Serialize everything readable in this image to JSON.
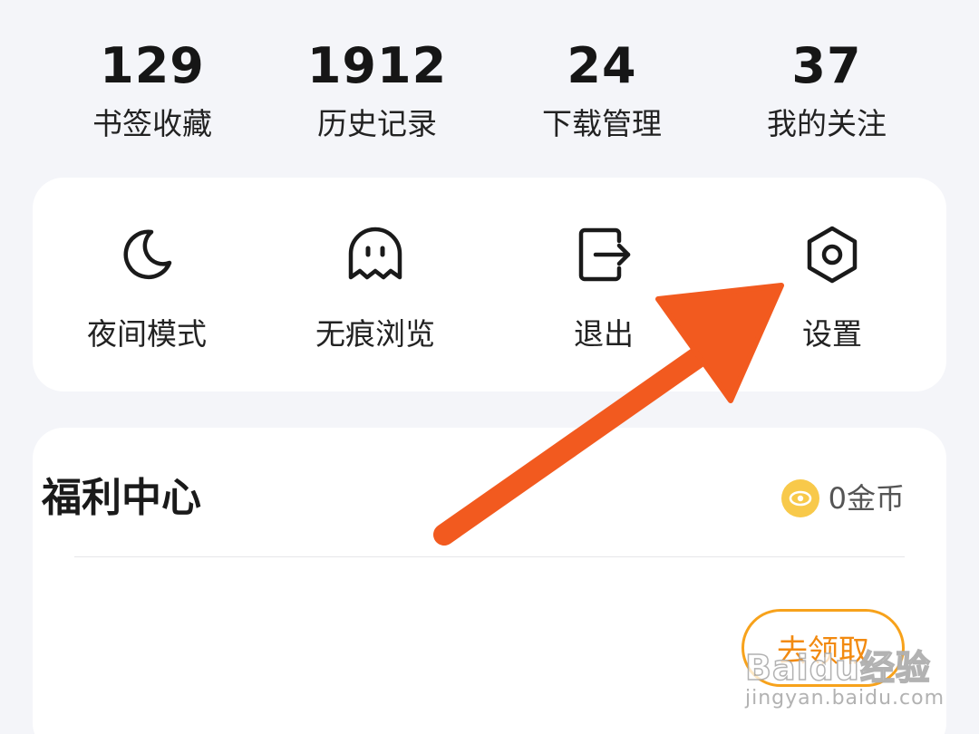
{
  "stats": [
    {
      "value": "129",
      "label": "书签收藏"
    },
    {
      "value": "1912",
      "label": "历史记录"
    },
    {
      "value": "24",
      "label": "下载管理"
    },
    {
      "value": "37",
      "label": "我的关注"
    }
  ],
  "tools": [
    {
      "icon": "moon-icon",
      "label": "夜间模式"
    },
    {
      "icon": "ghost-icon",
      "label": "无痕浏览"
    },
    {
      "icon": "logout-icon",
      "label": "退出"
    },
    {
      "icon": "settings-hexagon-icon",
      "label": "设置"
    }
  ],
  "welfare": {
    "title": "福利中心",
    "coins": "0金币",
    "claim_button": "去领取"
  },
  "watermark": {
    "brand": "Baidu经验",
    "url": "jingyan.baidu.com"
  },
  "colors": {
    "background": "#f4f5f9",
    "card": "#ffffff",
    "accent_orange": "#f7a21b",
    "annotation_arrow": "#f25a1f",
    "coin": "#f8c94a"
  }
}
